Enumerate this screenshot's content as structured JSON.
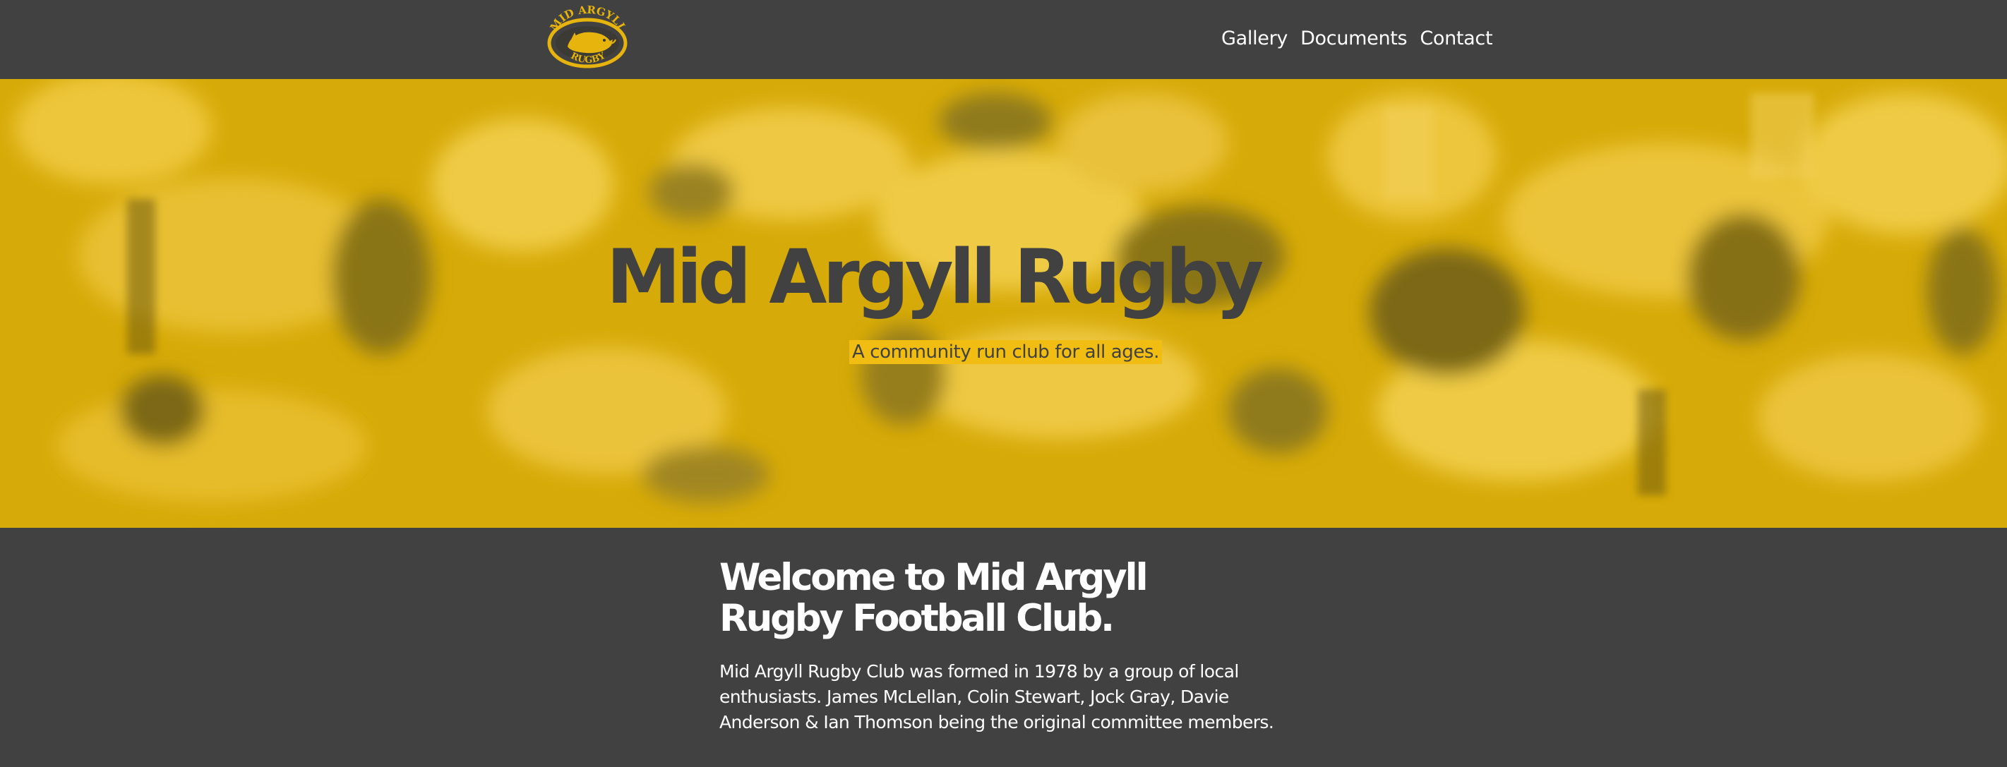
{
  "header": {
    "logo": {
      "top_text": "MID ARGYLL",
      "bottom_text": "RUGBY",
      "icon": "boar-logo-icon"
    },
    "nav": [
      {
        "label": "Gallery"
      },
      {
        "label": "Documents"
      },
      {
        "label": "Contact"
      }
    ]
  },
  "hero": {
    "title": "Mid Argyll Rugby",
    "tagline": "A community run club for all ages.",
    "background": "rugby-scrum-photo"
  },
  "welcome": {
    "heading": "Welcome to Mid Argyll Rugby Football Club.",
    "body": "Mid Argyll Rugby Club was formed in 1978 by a group of local enthusiasts. James McLellan, Colin Stewart, Jock Gray, Davie Anderson & Ian Thomson being the original committee members."
  },
  "colors": {
    "brand_yellow": "#e6b40c",
    "dark_gray": "#414141",
    "text_light": "#ffffff"
  }
}
